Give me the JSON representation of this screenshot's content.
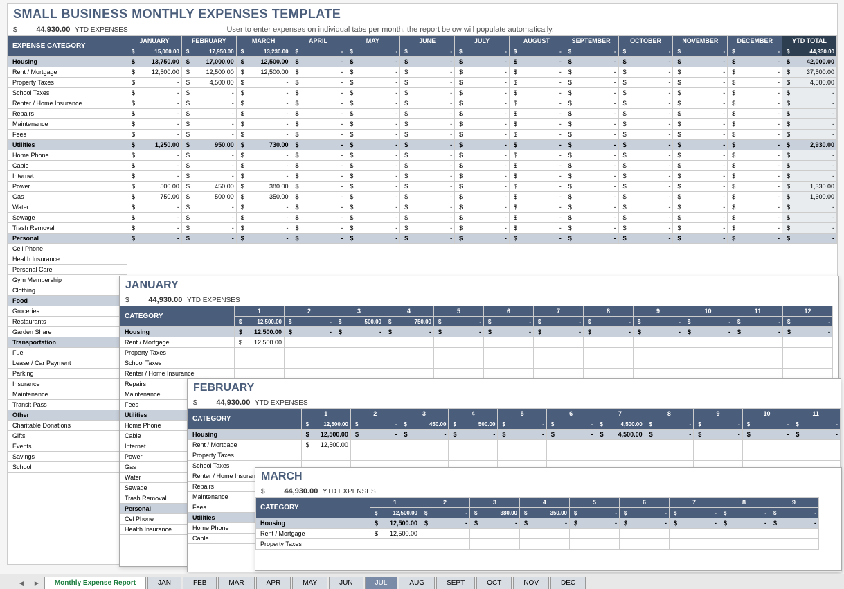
{
  "main": {
    "title": "SMALL BUSINESS MONTHLY EXPENSES TEMPLATE",
    "ytd_currency": "$",
    "ytd_amount": "44,930.00",
    "ytd_label": "YTD EXPENSES",
    "subtitle": "User to enter expenses on individual tabs per month, the report below will populate automatically.",
    "cat_header": "EXPENSE CATEGORY",
    "ytd_header": "YTD TOTAL",
    "months": [
      "JANUARY",
      "FEBRUARY",
      "MARCH",
      "APRIL",
      "MAY",
      "JUNE",
      "JULY",
      "AUGUST",
      "SEPTEMBER",
      "OCTOBER",
      "NOVEMBER",
      "DECEMBER"
    ],
    "month_totals": [
      "15,000.00",
      "17,950.00",
      "13,230.00",
      "-",
      "-",
      "-",
      "-",
      "-",
      "-",
      "-",
      "-",
      "-"
    ],
    "ytd_grand": "44,930.00",
    "rows": [
      {
        "type": "cat",
        "label": "Housing",
        "vals": [
          "13,750.00",
          "17,000.00",
          "12,500.00",
          "-",
          "-",
          "-",
          "-",
          "-",
          "-",
          "-",
          "-",
          "-"
        ],
        "ytd": "42,000.00"
      },
      {
        "type": "data",
        "label": "Rent / Mortgage",
        "vals": [
          "12,500.00",
          "12,500.00",
          "12,500.00",
          "-",
          "-",
          "-",
          "-",
          "-",
          "-",
          "-",
          "-",
          "-"
        ],
        "ytd": "37,500.00"
      },
      {
        "type": "data",
        "label": "Property Taxes",
        "vals": [
          "-",
          "4,500.00",
          "-",
          "-",
          "-",
          "-",
          "-",
          "-",
          "-",
          "-",
          "-",
          "-"
        ],
        "ytd": "4,500.00"
      },
      {
        "type": "data",
        "label": "School Taxes",
        "vals": [
          "-",
          "-",
          "-",
          "-",
          "-",
          "-",
          "-",
          "-",
          "-",
          "-",
          "-",
          "-"
        ],
        "ytd": "-"
      },
      {
        "type": "data",
        "label": "Renter / Home Insurance",
        "vals": [
          "-",
          "-",
          "-",
          "-",
          "-",
          "-",
          "-",
          "-",
          "-",
          "-",
          "-",
          "-"
        ],
        "ytd": "-"
      },
      {
        "type": "data",
        "label": "Repairs",
        "vals": [
          "-",
          "-",
          "-",
          "-",
          "-",
          "-",
          "-",
          "-",
          "-",
          "-",
          "-",
          "-"
        ],
        "ytd": "-"
      },
      {
        "type": "data",
        "label": "Maintenance",
        "vals": [
          "-",
          "-",
          "-",
          "-",
          "-",
          "-",
          "-",
          "-",
          "-",
          "-",
          "-",
          "-"
        ],
        "ytd": "-"
      },
      {
        "type": "data",
        "label": "Fees",
        "vals": [
          "-",
          "-",
          "-",
          "-",
          "-",
          "-",
          "-",
          "-",
          "-",
          "-",
          "-",
          "-"
        ],
        "ytd": "-"
      },
      {
        "type": "cat",
        "label": "Utilities",
        "vals": [
          "1,250.00",
          "950.00",
          "730.00",
          "-",
          "-",
          "-",
          "-",
          "-",
          "-",
          "-",
          "-",
          "-"
        ],
        "ytd": "2,930.00"
      },
      {
        "type": "data",
        "label": "Home Phone",
        "vals": [
          "-",
          "-",
          "-",
          "-",
          "-",
          "-",
          "-",
          "-",
          "-",
          "-",
          "-",
          "-"
        ],
        "ytd": "-"
      },
      {
        "type": "data",
        "label": "Cable",
        "vals": [
          "-",
          "-",
          "-",
          "-",
          "-",
          "-",
          "-",
          "-",
          "-",
          "-",
          "-",
          "-"
        ],
        "ytd": "-"
      },
      {
        "type": "data",
        "label": "Internet",
        "vals": [
          "-",
          "-",
          "-",
          "-",
          "-",
          "-",
          "-",
          "-",
          "-",
          "-",
          "-",
          "-"
        ],
        "ytd": "-"
      },
      {
        "type": "data",
        "label": "Power",
        "vals": [
          "500.00",
          "450.00",
          "380.00",
          "-",
          "-",
          "-",
          "-",
          "-",
          "-",
          "-",
          "-",
          "-"
        ],
        "ytd": "1,330.00"
      },
      {
        "type": "data",
        "label": "Gas",
        "vals": [
          "750.00",
          "500.00",
          "350.00",
          "-",
          "-",
          "-",
          "-",
          "-",
          "-",
          "-",
          "-",
          "-"
        ],
        "ytd": "1,600.00"
      },
      {
        "type": "data",
        "label": "Water",
        "vals": [
          "-",
          "-",
          "-",
          "-",
          "-",
          "-",
          "-",
          "-",
          "-",
          "-",
          "-",
          "-"
        ],
        "ytd": "-"
      },
      {
        "type": "data",
        "label": "Sewage",
        "vals": [
          "-",
          "-",
          "-",
          "-",
          "-",
          "-",
          "-",
          "-",
          "-",
          "-",
          "-",
          "-"
        ],
        "ytd": "-"
      },
      {
        "type": "data",
        "label": "Trash Removal",
        "vals": [
          "-",
          "-",
          "-",
          "-",
          "-",
          "-",
          "-",
          "-",
          "-",
          "-",
          "-",
          "-"
        ],
        "ytd": "-"
      },
      {
        "type": "cat",
        "label": "Personal",
        "vals": [
          "-",
          "-",
          "-",
          "-",
          "-",
          "-",
          "-",
          "-",
          "-",
          "-",
          "-",
          "-"
        ],
        "ytd": "-"
      },
      {
        "type": "data",
        "label": "Cell Phone"
      },
      {
        "type": "data",
        "label": "Health Insurance"
      },
      {
        "type": "data",
        "label": "Personal Care"
      },
      {
        "type": "data",
        "label": "Gym Membership"
      },
      {
        "type": "data",
        "label": "Clothing"
      },
      {
        "type": "cat",
        "label": "Food"
      },
      {
        "type": "data",
        "label": "Groceries"
      },
      {
        "type": "data",
        "label": "Restaurants"
      },
      {
        "type": "data",
        "label": "Garden Share"
      },
      {
        "type": "cat",
        "label": "Transportation"
      },
      {
        "type": "data",
        "label": "Fuel"
      },
      {
        "type": "data",
        "label": "Lease / Car Payment"
      },
      {
        "type": "data",
        "label": "Parking"
      },
      {
        "type": "data",
        "label": "Insurance"
      },
      {
        "type": "data",
        "label": "Maintenance"
      },
      {
        "type": "data",
        "label": "Transit Pass"
      },
      {
        "type": "cat",
        "label": "Other"
      },
      {
        "type": "data",
        "label": "Charitable Donations"
      },
      {
        "type": "data",
        "label": "Gifts"
      },
      {
        "type": "data",
        "label": "Events"
      },
      {
        "type": "data",
        "label": "Savings"
      },
      {
        "type": "data",
        "label": "School"
      }
    ]
  },
  "jan": {
    "title": "JANUARY",
    "ytd_amount": "44,930.00",
    "ytd_label": "YTD EXPENSES",
    "cat_header": "CATEGORY",
    "days": [
      "1",
      "2",
      "3",
      "4",
      "5",
      "6",
      "7",
      "8",
      "9",
      "10",
      "11",
      "12"
    ],
    "day_totals": [
      "12,500.00",
      "-",
      "500.00",
      "750.00",
      "-",
      "-",
      "-",
      "-",
      "-",
      "-",
      "-",
      "-"
    ],
    "rows": [
      {
        "type": "cat",
        "label": "Housing",
        "vals": [
          "12,500.00",
          "-",
          "-",
          "-",
          "-",
          "-",
          "-",
          "-",
          "-",
          "-",
          "-",
          "-"
        ]
      },
      {
        "type": "data",
        "label": "Rent / Mortgage",
        "vals": [
          "12,500.00",
          "",
          "",
          "",
          "",
          "",
          "",
          "",
          "",
          "",
          "",
          ""
        ]
      },
      {
        "type": "data",
        "label": "Property Taxes"
      },
      {
        "type": "data",
        "label": "School Taxes"
      },
      {
        "type": "data",
        "label": "Renter / Home Insurance"
      },
      {
        "type": "data",
        "label": "Repairs"
      },
      {
        "type": "data",
        "label": "Maintenance"
      },
      {
        "type": "data",
        "label": "Fees"
      },
      {
        "type": "cat",
        "label": "Utilities"
      },
      {
        "type": "data",
        "label": "Home Phone"
      },
      {
        "type": "data",
        "label": "Cable"
      },
      {
        "type": "data",
        "label": "Internet"
      },
      {
        "type": "data",
        "label": "Power"
      },
      {
        "type": "data",
        "label": "Gas"
      },
      {
        "type": "data",
        "label": "Water"
      },
      {
        "type": "data",
        "label": "Sewage"
      },
      {
        "type": "data",
        "label": "Trash Removal"
      },
      {
        "type": "cat",
        "label": "Personal"
      },
      {
        "type": "data",
        "label": "Cel Phone"
      },
      {
        "type": "data",
        "label": "Health Insurance"
      }
    ]
  },
  "feb": {
    "title": "FEBRUARY",
    "ytd_amount": "44,930.00",
    "ytd_label": "YTD EXPENSES",
    "cat_header": "CATEGORY",
    "days": [
      "1",
      "2",
      "3",
      "4",
      "5",
      "6",
      "7",
      "8",
      "9",
      "10",
      "11"
    ],
    "day_totals": [
      "12,500.00",
      "-",
      "450.00",
      "500.00",
      "-",
      "-",
      "4,500.00",
      "-",
      "-",
      "-",
      "-"
    ],
    "rows": [
      {
        "type": "cat",
        "label": "Housing",
        "vals": [
          "12,500.00",
          "-",
          "-",
          "-",
          "-",
          "-",
          "4,500.00",
          "-",
          "-",
          "-",
          "-"
        ]
      },
      {
        "type": "data",
        "label": "Rent / Mortgage",
        "vals": [
          "12,500.00",
          "",
          "",
          "",
          "",
          "",
          "",
          "",
          "",
          "",
          ""
        ]
      },
      {
        "type": "data",
        "label": "Property Taxes"
      },
      {
        "type": "data",
        "label": "School Taxes"
      },
      {
        "type": "data",
        "label": "Renter / Home Insurance"
      },
      {
        "type": "data",
        "label": "Repairs"
      },
      {
        "type": "data",
        "label": "Maintenance"
      },
      {
        "type": "data",
        "label": "Fees"
      },
      {
        "type": "cat",
        "label": "Utilities"
      },
      {
        "type": "data",
        "label": "Home Phone"
      },
      {
        "type": "data",
        "label": "Cable"
      }
    ]
  },
  "mar": {
    "title": "MARCH",
    "ytd_amount": "44,930.00",
    "ytd_label": "YTD EXPENSES",
    "cat_header": "CATEGORY",
    "days": [
      "1",
      "2",
      "3",
      "4",
      "5",
      "6",
      "7",
      "8",
      "9"
    ],
    "day_totals": [
      "12,500.00",
      "-",
      "380.00",
      "350.00",
      "-",
      "-",
      "-",
      "-",
      "-"
    ],
    "rows": [
      {
        "type": "cat",
        "label": "Housing",
        "vals": [
          "12,500.00",
          "-",
          "-",
          "-",
          "-",
          "-",
          "-",
          "-",
          "-"
        ]
      },
      {
        "type": "data",
        "label": "Rent / Mortgage",
        "vals": [
          "12,500.00",
          "",
          "",
          "",
          "",
          "",
          "",
          "",
          ""
        ]
      },
      {
        "type": "data",
        "label": "Property Taxes"
      }
    ]
  },
  "tabs": {
    "active": "Monthly Expense Report",
    "items": [
      "JAN",
      "FEB",
      "MAR",
      "APR",
      "MAY",
      "JUN",
      "JUL",
      "AUG",
      "SEPT",
      "OCT",
      "NOV",
      "DEC"
    ]
  }
}
